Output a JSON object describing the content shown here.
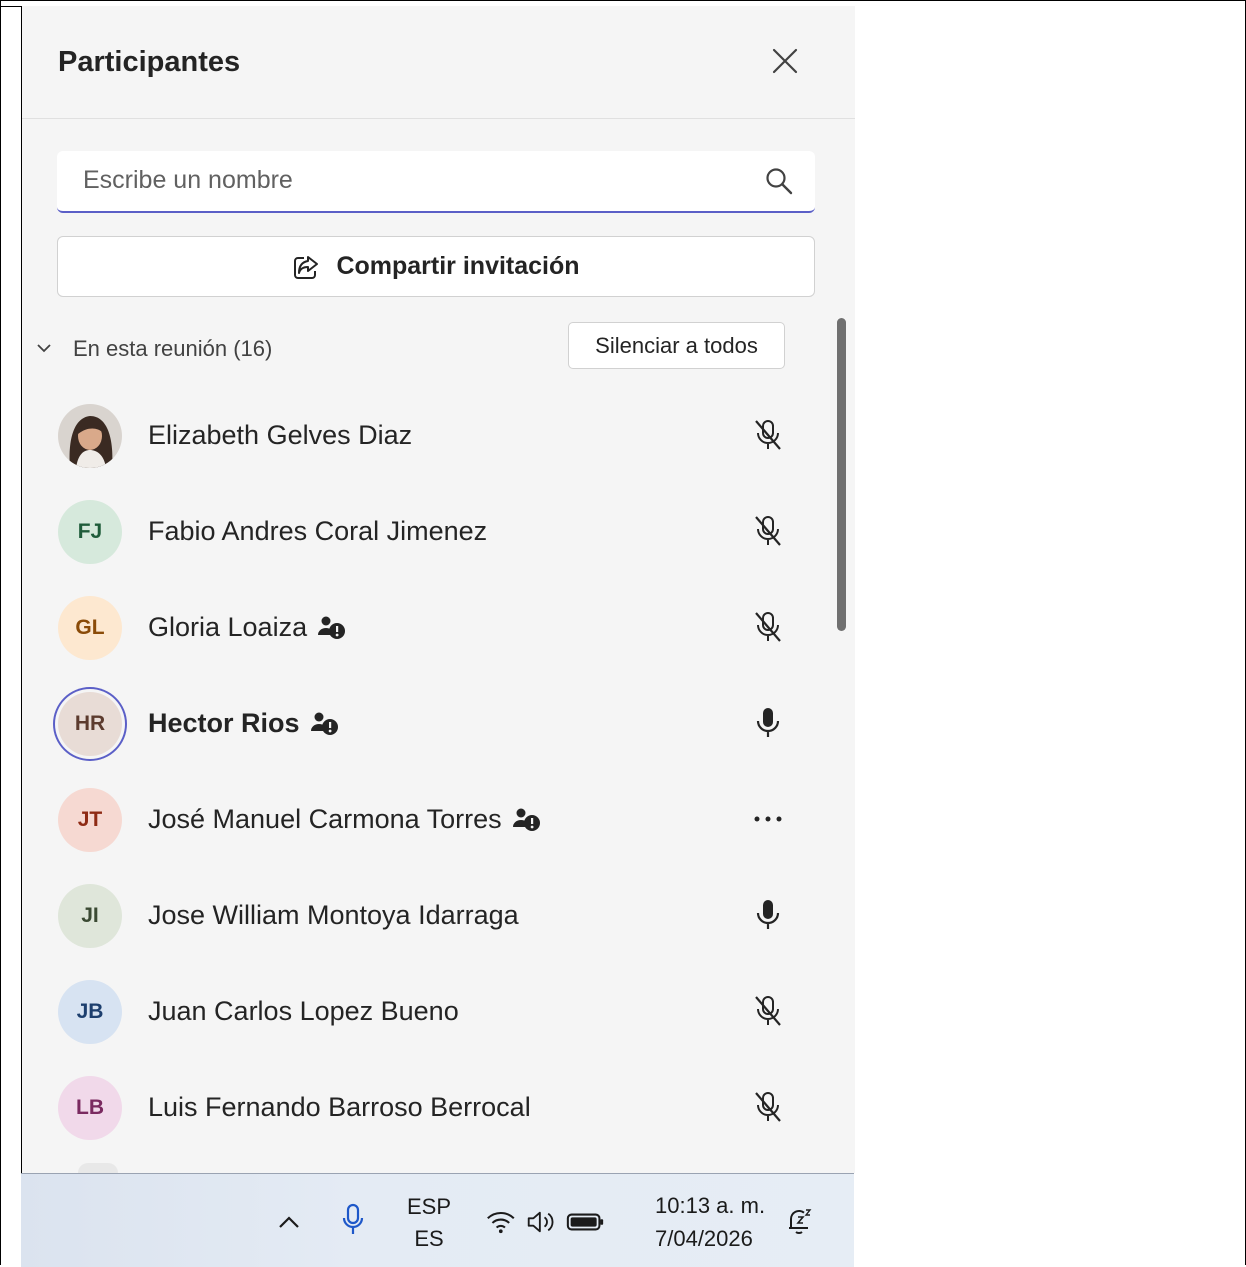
{
  "panel": {
    "title": "Participantes",
    "search_placeholder": "Escribe un nombre",
    "share_label": "Compartir invitación",
    "section_label": "En esta reunión (16)",
    "mute_all_label": "Silenciar a todos"
  },
  "participants": [
    {
      "initials": "",
      "name": "Elizabeth Gelves Diaz",
      "status": "mic-off-icon",
      "photo": true
    },
    {
      "initials": "FJ",
      "name": "Fabio Andres Coral Jimenez",
      "status": "mic-off-icon",
      "avatar_bg": "#d6e9dc",
      "avatar_fg": "#1f5c3a"
    },
    {
      "initials": "GL",
      "name": "Gloria Loaiza",
      "status": "mic-off-icon",
      "badge": "external-user-icon",
      "avatar_bg": "#fde8d0",
      "avatar_fg": "#8a4b08"
    },
    {
      "initials": "HR",
      "name": "Hector Rios",
      "status": "mic-on-icon",
      "badge": "external-user-icon",
      "avatar_bg": "#e8dcd6",
      "avatar_fg": "#5c3b2e",
      "speaking": true
    },
    {
      "initials": "JT",
      "name": "José Manuel Carmona Torres",
      "status": "more-options-icon",
      "badge": "external-user-icon",
      "avatar_bg": "#f6d9d2",
      "avatar_fg": "#8e2a14"
    },
    {
      "initials": "JI",
      "name": "Jose William Montoya Idarraga",
      "status": "mic-on-icon",
      "avatar_bg": "#dfe6da",
      "avatar_fg": "#3b4a33"
    },
    {
      "initials": "JB",
      "name": "Juan Carlos Lopez Bueno",
      "status": "mic-off-icon",
      "avatar_bg": "#d7e3f2",
      "avatar_fg": "#1d3f6e"
    },
    {
      "initials": "LB",
      "name": "Luis Fernando Barroso Berrocal",
      "status": "mic-off-icon",
      "avatar_bg": "#f1d9ea",
      "avatar_fg": "#7a2a60"
    }
  ],
  "taskbar": {
    "lang_top": "ESP",
    "lang_bottom": "ES",
    "time": "10:13 a. m.",
    "date": "7/04/2026"
  },
  "colors": {
    "accent": "#5b5fc7",
    "panel_bg": "#f5f5f5"
  }
}
